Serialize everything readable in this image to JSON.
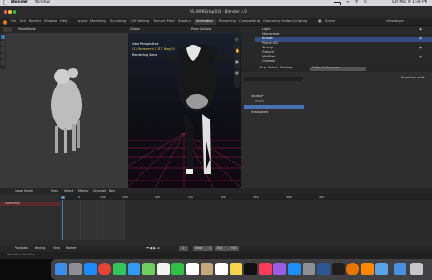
{
  "mac_menubar": {
    "app": "Blender",
    "menu": "Window",
    "clock": "Sat Mar 9 1:49 PM"
  },
  "window_title": "RS.WPKS(top03) - Blender 4.0",
  "blender_menu": [
    "File",
    "Edit",
    "Render",
    "Window",
    "Help"
  ],
  "workspaces": [
    "Layout",
    "Modeling",
    "Sculpting",
    "UV Editing",
    "Texture Paint",
    "Shading",
    "Animation",
    "Rendering",
    "Compositing",
    "Geometry Nodes",
    "Scripting"
  ],
  "active_workspace": "Animation",
  "scene": {
    "label": "Scene",
    "viewlayer": "ViewLayer"
  },
  "left_viewport": {
    "mode": "Pose Mode"
  },
  "viewport": {
    "mode": "Pose Mode",
    "perspective": "User Perspective",
    "object": "(1) Movement | 377 Bag.00",
    "status": "Rendering Done",
    "options": "Pose Options",
    "global": "Global"
  },
  "outliner": {
    "items": [
      "Light",
      "Movement",
      "Armat",
      "Plane.002",
      "Sheep",
      "Ground",
      "MidPlain",
      "Camera"
    ]
  },
  "asset_browser": {
    "header": [
      "View",
      "Select",
      "Catalog"
    ],
    "library": "Folder Preferences",
    "tree": [
      "Catalog*",
      "Image"
    ],
    "selected": "Unassigned",
    "empty_message": "No active asset",
    "search_placeholder": ""
  },
  "dopesheet": {
    "editor": "Dope Sheet",
    "menu": [
      "View",
      "Select",
      "Marker",
      "Channel",
      "Key"
    ],
    "channel": "Summary",
    "frames": [
      "0",
      "100",
      "150",
      "200",
      "250",
      "300",
      "350",
      "400",
      "450"
    ],
    "playback_menu": [
      "Playback",
      "Keying",
      "View",
      "Marker"
    ],
    "current_frame": "1",
    "start_label": "Start",
    "start": "1",
    "end_label": "End",
    "end": "250"
  },
  "statusbar": {
    "left": "Set Active Modifier"
  },
  "dock_icons": [
    "finder-icon",
    "launchpad-icon",
    "safari-icon",
    "chrome-icon",
    "messages-icon",
    "mail-icon",
    "maps-icon",
    "photos-icon",
    "facetime-icon",
    "calendar-icon",
    "contacts-icon",
    "reminders-icon",
    "notes-icon",
    "tv-icon",
    "music-icon",
    "podcasts-icon",
    "appstore-icon",
    "settings-icon",
    "word-icon",
    "terminal-icon",
    "blender-icon",
    "vlc-icon",
    "preview-icon",
    "downloads-icon",
    "trash-icon"
  ]
}
